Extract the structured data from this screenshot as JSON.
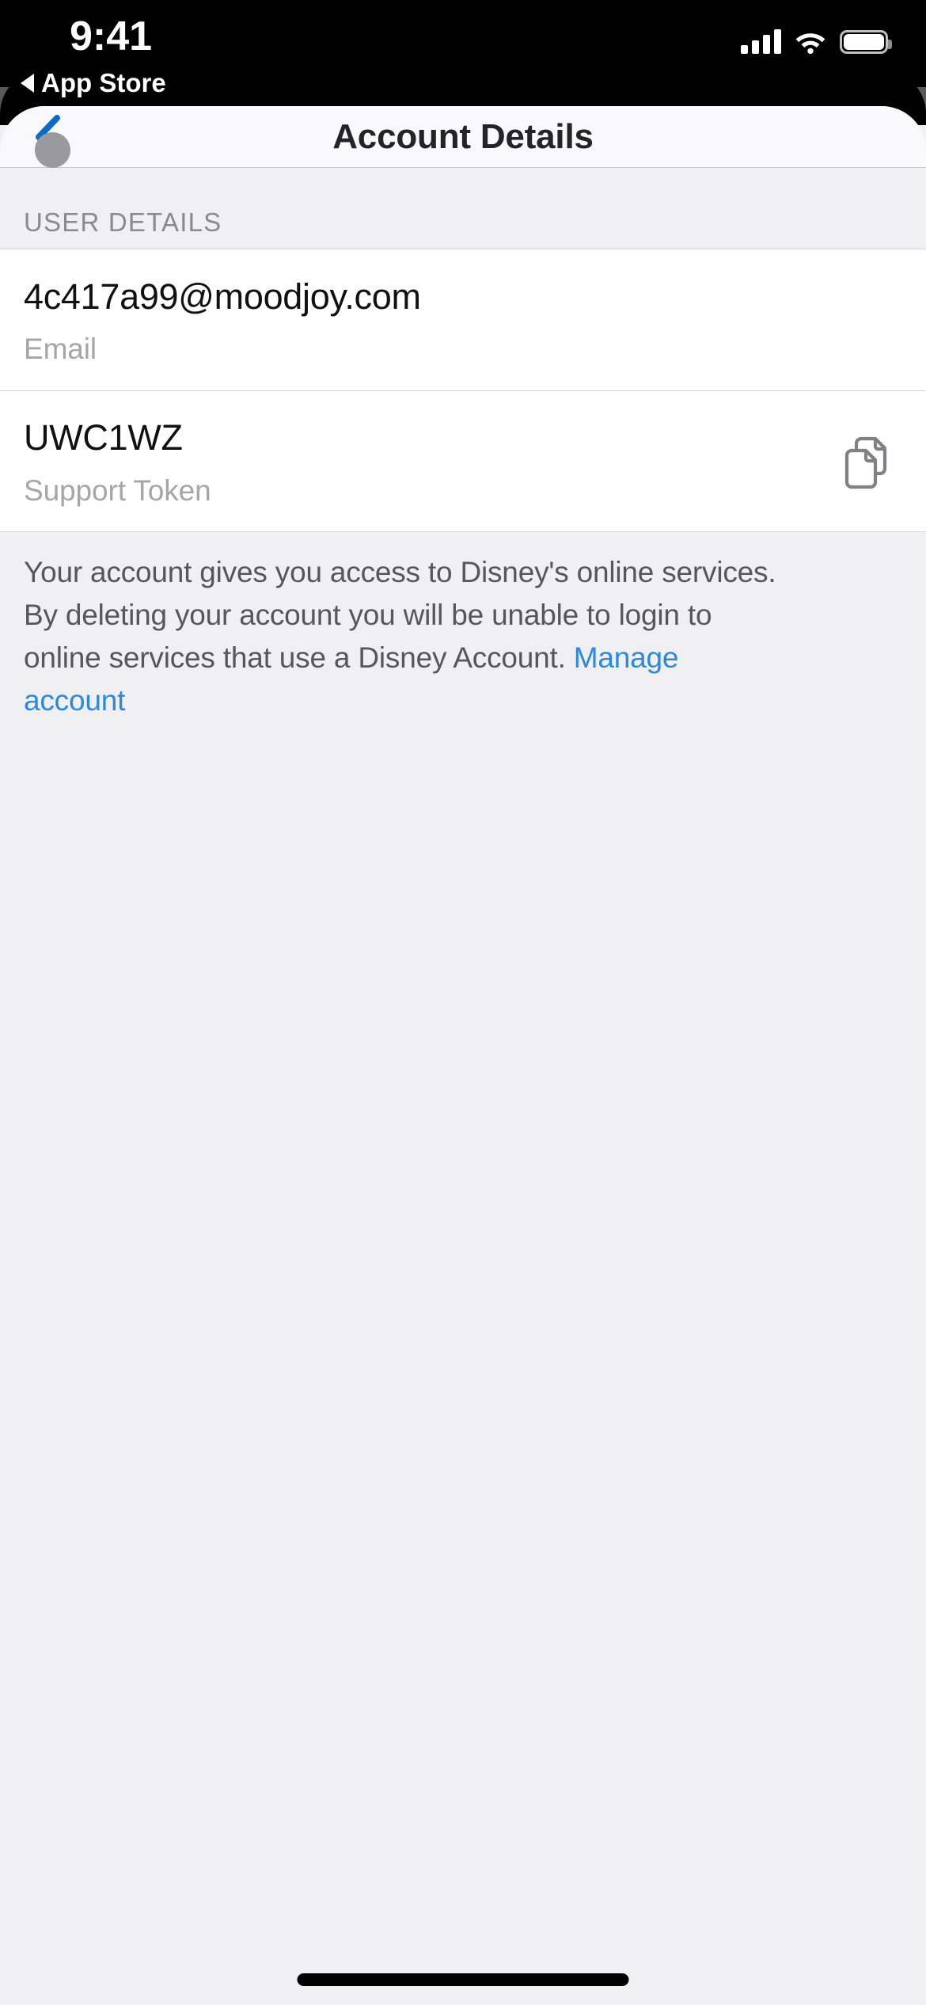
{
  "status_bar": {
    "time": "9:41",
    "return_app_label": "App Store",
    "return_icon": "triangle-left-icon",
    "signal_icon": "cellular-signal-icon",
    "signal_bars": 4,
    "wifi_icon": "wifi-icon",
    "battery_icon": "battery-icon",
    "battery_level": 100
  },
  "nav_bar": {
    "back_icon": "chevron-left-icon",
    "title": "Account Details",
    "accent_color": "#0a6cc4"
  },
  "touch_indicator": {
    "name": "touch-indicator",
    "color": "#9a9a9e"
  },
  "section": {
    "header": "USER DETAILS",
    "rows": [
      {
        "value": "4c417a99@moodjoy.com",
        "label": "Email",
        "action_icon": null
      },
      {
        "value": "UWC1WZ",
        "label": "Support Token",
        "action_icon": "copy-icon"
      }
    ]
  },
  "footer": {
    "line1": "Your account gives you access to Disney's online services.",
    "line2": "By deleting your account you will be unable to login to",
    "line3": "online services that use a Disney Account.",
    "link_text": "Manage account",
    "link_color": "#2b8ae0"
  },
  "home_indicator": {
    "name": "home-indicator",
    "color": "#000000"
  },
  "colors": {
    "page_background": "#f0f0f2",
    "card_background": "#ffffff",
    "nav_background": "#f9f9fb",
    "separator": "#d4d4d6",
    "secondary_text": "#8a8a8e",
    "value_text": "#111113",
    "label_text": "#a6a6aa"
  }
}
